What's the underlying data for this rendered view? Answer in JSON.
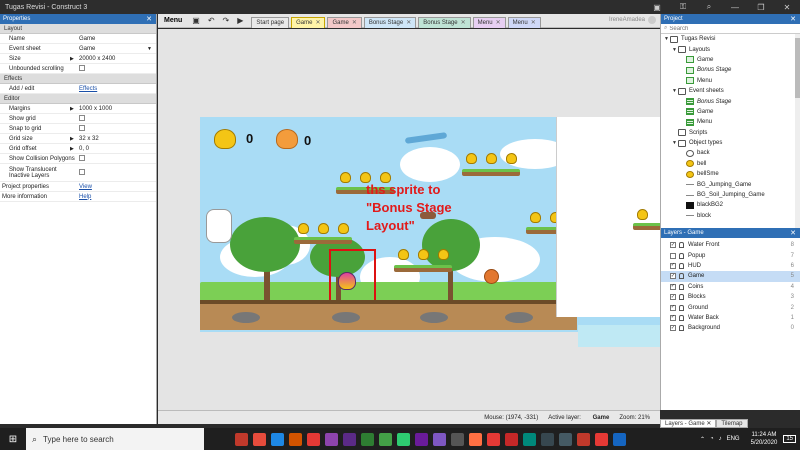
{
  "window": {
    "title": "Tugas Revisi - Construct 3",
    "icons": [
      "▣",
      "⚿",
      "⌕",
      "—",
      "❐",
      "✕"
    ]
  },
  "properties": {
    "header": "Properties",
    "sections": {
      "layout": "Layout",
      "effects": "Effects",
      "editor": "Editor"
    },
    "rows": {
      "name": {
        "label": "Name",
        "value": "Game"
      },
      "event_sheet": {
        "label": "Event sheet",
        "value": "Game"
      },
      "size": {
        "label": "Size",
        "value": "20000 x 2400"
      },
      "unbounded": {
        "label": "Unbounded scrolling"
      },
      "add_edit": {
        "label": "Add / edit",
        "value": "Effects"
      },
      "margins": {
        "label": "Margins",
        "value": "1000 x 1000"
      },
      "show_grid": {
        "label": "Show grid"
      },
      "snap_grid": {
        "label": "Snap to grid"
      },
      "grid_size": {
        "label": "Grid size",
        "value": "32 x 32"
      },
      "grid_offset": {
        "label": "Grid offset",
        "value": "0, 0"
      },
      "show_collision": {
        "label": "Show Collision Polygons"
      },
      "show_translucent": {
        "label": "Show Translucent Inactive Layers"
      },
      "project_props": {
        "label": "Project properties",
        "value": "View"
      },
      "more_info": {
        "label": "More information",
        "value": "Help"
      }
    }
  },
  "toolbar": {
    "menu": "Menu",
    "tabs": [
      "Start page",
      "Game",
      "Game",
      "Bonus Stage",
      "Bonus Stage",
      "Menu",
      "Menu"
    ],
    "tab_colors": [
      "#e9e9e9",
      "#fff4a8",
      "#f4c9c9",
      "#cfe6f7",
      "#bfe3d5",
      "#e7cff2",
      "#cfd8f7"
    ],
    "user": "IreneAmadea"
  },
  "canvas": {
    "hud_count_1": "0",
    "hud_count_2": "0",
    "annotation": "ths sprite to\n\"Bonus Stage\nLayout\""
  },
  "status": {
    "mouse": "Mouse: (1974, -331)",
    "active_layer_label": "Active layer:",
    "active_layer": "Game",
    "zoom": "Zoom: 21%"
  },
  "project": {
    "header": "Project",
    "search_placeholder": "Search",
    "tree": [
      {
        "label": "Tugas Revisi",
        "indent": 0,
        "icon": "folder",
        "arrow": "▼"
      },
      {
        "label": "Layouts",
        "indent": 1,
        "icon": "folder",
        "arrow": "▼"
      },
      {
        "label": "Game",
        "indent": 2,
        "icon": "layout",
        "italic": true
      },
      {
        "label": "Bonus Stage",
        "indent": 2,
        "icon": "layout",
        "italic": true
      },
      {
        "label": "Menu",
        "indent": 2,
        "icon": "layout"
      },
      {
        "label": "Event sheets",
        "indent": 1,
        "icon": "folder",
        "arrow": "▼"
      },
      {
        "label": "Bonus Stage",
        "indent": 2,
        "icon": "es",
        "italic": true
      },
      {
        "label": "Game",
        "indent": 2,
        "icon": "es",
        "italic": true
      },
      {
        "label": "Menu",
        "indent": 2,
        "icon": "es"
      },
      {
        "label": "Scripts",
        "indent": 1,
        "icon": "folder"
      },
      {
        "label": "Object types",
        "indent": 1,
        "icon": "folder",
        "arrow": "▼"
      },
      {
        "label": "back",
        "indent": 2,
        "icon": "obj"
      },
      {
        "label": "bell",
        "indent": 2,
        "icon": "bellic"
      },
      {
        "label": "bellSme",
        "indent": 2,
        "icon": "bellic"
      },
      {
        "label": "BG_Jumping_Game",
        "indent": 2,
        "icon": "line"
      },
      {
        "label": "BG_Soil_Jumping_Game",
        "indent": 2,
        "icon": "line"
      },
      {
        "label": "blackBG2",
        "indent": 2,
        "icon": "blk"
      },
      {
        "label": "block",
        "indent": 2,
        "icon": "line"
      }
    ]
  },
  "layers": {
    "header": "Layers - Game",
    "items": [
      {
        "name": "Water Front",
        "num": "8",
        "checked": true
      },
      {
        "name": "Popup",
        "num": "7",
        "checked": false
      },
      {
        "name": "HUD",
        "num": "6",
        "checked": true
      },
      {
        "name": "Game",
        "num": "5",
        "checked": true,
        "selected": true
      },
      {
        "name": "Coins",
        "num": "4",
        "checked": true
      },
      {
        "name": "Blocks",
        "num": "3",
        "checked": true
      },
      {
        "name": "Ground",
        "num": "2",
        "checked": true
      },
      {
        "name": "Water Back",
        "num": "1",
        "checked": true
      },
      {
        "name": "Background",
        "num": "0",
        "checked": true
      }
    ]
  },
  "bottom_tabs": [
    "Layers - Game",
    "Tilemap"
  ],
  "taskbar": {
    "search_placeholder": "Type here to search",
    "app_colors": [
      "#c0392b",
      "#e74c3c",
      "#1e88e5",
      "#d35400",
      "#e53935",
      "#8e44ad",
      "#5b2a86",
      "#2e7d32",
      "#43a047",
      "#2ecc71",
      "#6a1b9a",
      "#7e57c2",
      "#555555",
      "#ff7043",
      "#e53935",
      "#c62828",
      "#00897b",
      "#37474f",
      "#455a64",
      "#c0392b",
      "#e53935",
      "#1565c0"
    ],
    "time": "11:24 AM",
    "date": "5/20/2020",
    "lang": "ENG",
    "notif": "15"
  }
}
